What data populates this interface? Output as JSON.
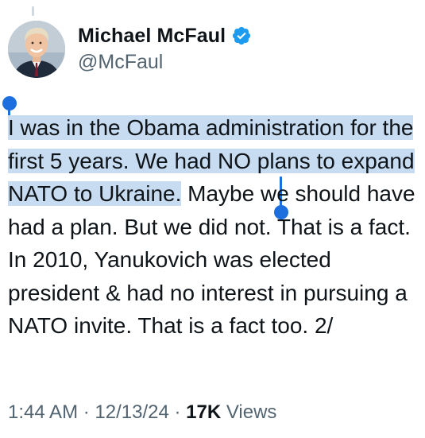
{
  "author": {
    "display_name": "Michael McFaul",
    "handle": "@McFaul",
    "verified": true,
    "avatar_icon": "profile-photo"
  },
  "tweet": {
    "selected_text_1": "I was in the Obama administration for the first 5 years. We had NO plans to expand NATO to Ukraine.",
    "unselected_text": " Maybe we should have had a plan.  But we did not. That is a fact. In 2010, Yanukovich was elected president & had no interest in pursuing a NATO invite.  That is a fact too. 2/"
  },
  "meta": {
    "time": "1:44 AM",
    "separator_1": " · ",
    "date": "12/13/24",
    "separator_2": " · ",
    "views_count": "17K",
    "views_label": " Views"
  },
  "colors": {
    "selection": "#c8dcf1",
    "selection_handle": "#1d6fe0",
    "verified_badge": "#1d9bf0",
    "secondary_text": "#536471"
  }
}
